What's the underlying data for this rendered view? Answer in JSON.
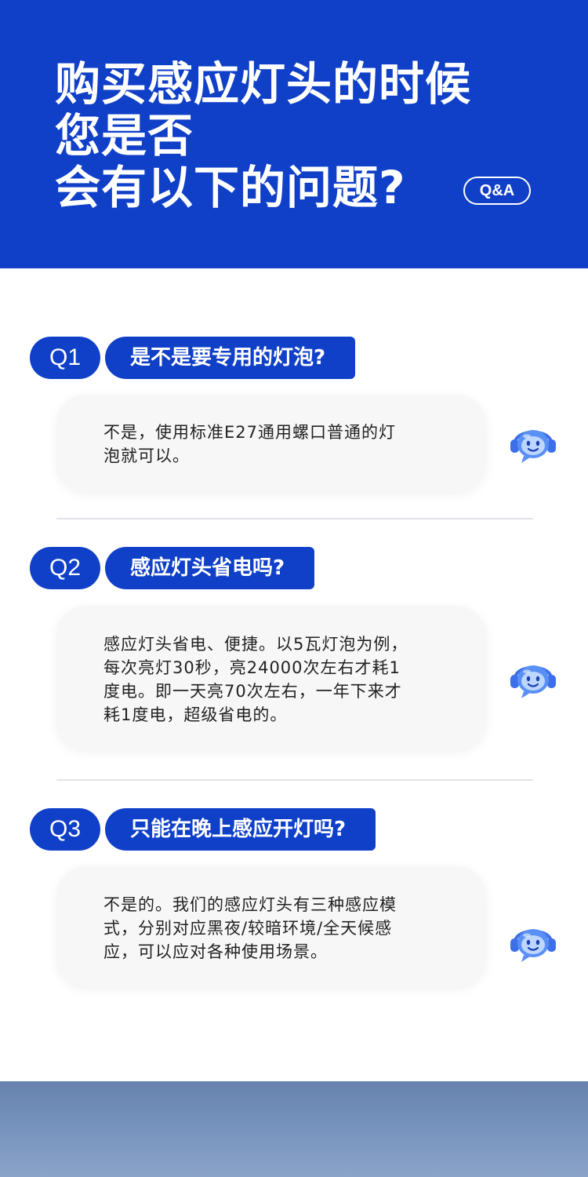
{
  "hero": {
    "title_line1": "购买感应灯头的时候",
    "title_line2": "您是否",
    "title_line3": "会有以下的问题?",
    "badge": "Q&A"
  },
  "qa": [
    {
      "number": "Q1",
      "question": "是不是要专用的灯泡?",
      "answer_lines": [
        "不是，使用标准E27通用螺口普通的灯",
        "泡就可以。"
      ]
    },
    {
      "number": "Q2",
      "question": "感应灯头省电吗?",
      "answer_lines": [
        "感应灯头省电、便捷。以5瓦灯泡为例，",
        "每次亮灯30秒，亮24000次左右才耗1",
        "度电。即一天亮70次左右，一年下来才",
        "耗1度电，超级省电的。"
      ]
    },
    {
      "number": "Q3",
      "question": "只能在晚上感应开灯吗?",
      "answer_lines": [
        "不是的。我们的感应灯头有三种感应模",
        "式，分别对应黑夜/较暗环境/全天候感",
        "应，可以应对各种使用场景。"
      ]
    }
  ],
  "icons": {
    "assistant": "support-bot-icon"
  },
  "colors": {
    "brand_blue": "#1040c8",
    "card_bg": "#f7f7f8",
    "text": "#222222"
  }
}
